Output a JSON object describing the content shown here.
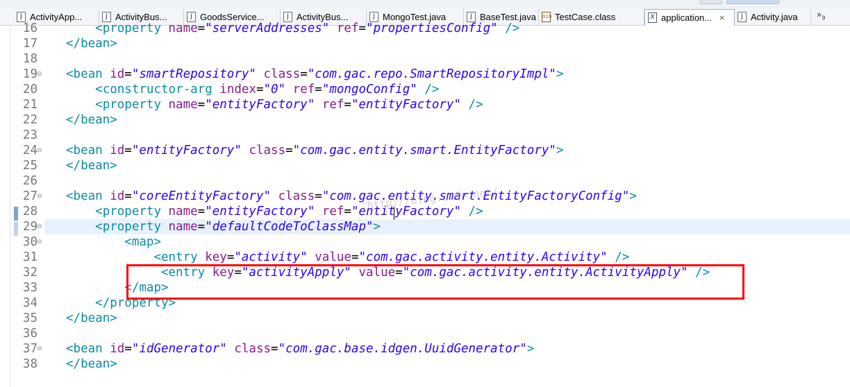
{
  "tabs": [
    {
      "label": "ActivityApp...",
      "icon": "java-file-icon",
      "active": false
    },
    {
      "label": "ActivityBus...",
      "icon": "java-file-icon",
      "active": false
    },
    {
      "label": "GoodsService...",
      "icon": "java-file-icon",
      "active": false
    },
    {
      "label": "ActivityBus...",
      "icon": "java-file-icon",
      "active": false
    },
    {
      "label": "MongoTest.java",
      "icon": "java-file-icon",
      "active": false
    },
    {
      "label": "BaseTest.java",
      "icon": "java-file-icon",
      "active": false
    },
    {
      "label": "TestCase.class",
      "icon": "class-file-icon",
      "active": false
    },
    {
      "label": "application...",
      "icon": "xml-file-icon",
      "active": true,
      "close": "×"
    },
    {
      "label": "Activity.java",
      "icon": "java-file-icon",
      "active": false
    }
  ],
  "overflow": {
    "glyph": "»",
    "count": "9"
  },
  "editor": {
    "watermark": "http://blog.csdn.net/",
    "lines": [
      {
        "num": "16",
        "fold": "",
        "code": [
          [
            "p",
            "    "
          ],
          [
            "t",
            "<property "
          ],
          [
            "a",
            "name"
          ],
          [
            "p",
            "="
          ],
          [
            "v",
            "\"serverAddresses\""
          ],
          [
            "p",
            " "
          ],
          [
            "a",
            "ref"
          ],
          [
            "p",
            "="
          ],
          [
            "v",
            "\"propertiesConfig\""
          ],
          [
            "t",
            " />"
          ]
        ]
      },
      {
        "num": "17",
        "fold": "",
        "code": [
          [
            "t",
            "</bean>"
          ]
        ]
      },
      {
        "num": "18",
        "fold": "",
        "code": []
      },
      {
        "num": "19",
        "fold": "⊖",
        "code": [
          [
            "t",
            "<bean "
          ],
          [
            "a",
            "id"
          ],
          [
            "p",
            "="
          ],
          [
            "v",
            "\"smartRepository\""
          ],
          [
            "p",
            " "
          ],
          [
            "a",
            "class"
          ],
          [
            "p",
            "="
          ],
          [
            "v",
            "\"com.gac.repo.SmartRepositoryImpl\""
          ],
          [
            "t",
            ">"
          ]
        ]
      },
      {
        "num": "20",
        "fold": "",
        "code": [
          [
            "p",
            "    "
          ],
          [
            "t",
            "<constructor-arg "
          ],
          [
            "a",
            "index"
          ],
          [
            "p",
            "="
          ],
          [
            "v",
            "\"0\""
          ],
          [
            "p",
            " "
          ],
          [
            "a",
            "ref"
          ],
          [
            "p",
            "="
          ],
          [
            "v",
            "\"mongoConfig\""
          ],
          [
            "t",
            " />"
          ]
        ]
      },
      {
        "num": "21",
        "fold": "",
        "code": [
          [
            "p",
            "    "
          ],
          [
            "t",
            "<property "
          ],
          [
            "a",
            "name"
          ],
          [
            "p",
            "="
          ],
          [
            "v",
            "\"entityFactory\""
          ],
          [
            "p",
            " "
          ],
          [
            "a",
            "ref"
          ],
          [
            "p",
            "="
          ],
          [
            "v",
            "\"entityFactory\""
          ],
          [
            "t",
            " />"
          ]
        ]
      },
      {
        "num": "22",
        "fold": "",
        "code": [
          [
            "t",
            "</bean>"
          ]
        ]
      },
      {
        "num": "23",
        "fold": "",
        "code": []
      },
      {
        "num": "24",
        "fold": "⊖",
        "code": [
          [
            "t",
            "<bean "
          ],
          [
            "a",
            "id"
          ],
          [
            "p",
            "="
          ],
          [
            "v",
            "\"entityFactory\""
          ],
          [
            "p",
            " "
          ],
          [
            "a",
            "class"
          ],
          [
            "p",
            "="
          ],
          [
            "v",
            "\"com.gac.entity.smart.EntityFactory\""
          ],
          [
            "t",
            ">"
          ]
        ]
      },
      {
        "num": "25",
        "fold": "",
        "code": [
          [
            "t",
            "</bean>"
          ]
        ]
      },
      {
        "num": "26",
        "fold": "",
        "code": []
      },
      {
        "num": "27",
        "fold": "⊖",
        "code": [
          [
            "t",
            "<bean "
          ],
          [
            "a",
            "id"
          ],
          [
            "p",
            "="
          ],
          [
            "v",
            "\"coreEntityFactory\""
          ],
          [
            "p",
            " "
          ],
          [
            "a",
            "class"
          ],
          [
            "p",
            "="
          ],
          [
            "v",
            "\"com.gac.entity.smart.EntityFactoryConfig\""
          ],
          [
            "t",
            ">"
          ]
        ]
      },
      {
        "num": "28",
        "fold": "",
        "code": [
          [
            "p",
            "    "
          ],
          [
            "t",
            "<property "
          ],
          [
            "a",
            "name"
          ],
          [
            "p",
            "="
          ],
          [
            "v",
            "\"entityFactory\""
          ],
          [
            "p",
            " "
          ],
          [
            "a",
            "ref"
          ],
          [
            "p",
            "="
          ],
          [
            "v",
            "\"entityFactory\""
          ],
          [
            "t",
            " />"
          ]
        ]
      },
      {
        "num": "29",
        "fold": "⊖",
        "current": true,
        "code": [
          [
            "p",
            "    "
          ],
          [
            "t",
            "<property "
          ],
          [
            "a",
            "name"
          ],
          [
            "p",
            "="
          ],
          [
            "v",
            "\"defaultCodeToClassMap\""
          ],
          [
            "t",
            ">"
          ]
        ]
      },
      {
        "num": "30",
        "fold": "⊖",
        "code": [
          [
            "p",
            "        "
          ],
          [
            "t",
            "<map>"
          ]
        ]
      },
      {
        "num": "31",
        "fold": "",
        "code": [
          [
            "p",
            "            "
          ],
          [
            "t",
            "<entry "
          ],
          [
            "a",
            "key"
          ],
          [
            "p",
            "="
          ],
          [
            "v",
            "\"activity\""
          ],
          [
            "p",
            " "
          ],
          [
            "a",
            "value"
          ],
          [
            "p",
            "="
          ],
          [
            "v",
            "\"com.gac.activity.entity.Activity\""
          ],
          [
            "t",
            " />"
          ]
        ]
      },
      {
        "num": "32",
        "fold": "",
        "code": [
          [
            "p",
            "             "
          ],
          [
            "t",
            "<entry "
          ],
          [
            "a",
            "key"
          ],
          [
            "p",
            "="
          ],
          [
            "v",
            "\"activityApply\""
          ],
          [
            "p",
            " "
          ],
          [
            "a",
            "value"
          ],
          [
            "p",
            "="
          ],
          [
            "v",
            "\"com.gac.activity.entity.ActivityApply\""
          ],
          [
            "t",
            " />"
          ]
        ]
      },
      {
        "num": "33",
        "fold": "",
        "code": [
          [
            "p",
            "        "
          ],
          [
            "t",
            "</map>"
          ]
        ]
      },
      {
        "num": "34",
        "fold": "",
        "code": [
          [
            "p",
            "    "
          ],
          [
            "t",
            "</property>"
          ]
        ]
      },
      {
        "num": "35",
        "fold": "",
        "code": [
          [
            "t",
            "</bean>"
          ]
        ]
      },
      {
        "num": "36",
        "fold": "",
        "code": []
      },
      {
        "num": "37",
        "fold": "⊖",
        "code": [
          [
            "t",
            "<bean "
          ],
          [
            "a",
            "id"
          ],
          [
            "p",
            "="
          ],
          [
            "v",
            "\"idGenerator\""
          ],
          [
            "p",
            " "
          ],
          [
            "a",
            "class"
          ],
          [
            "p",
            "="
          ],
          [
            "v",
            "\"com.gac.base.idgen.UuidGenerator\""
          ],
          [
            "t",
            ">"
          ]
        ]
      },
      {
        "num": "38",
        "fold": "",
        "code": [
          [
            "t",
            "</bean>"
          ]
        ]
      }
    ]
  }
}
